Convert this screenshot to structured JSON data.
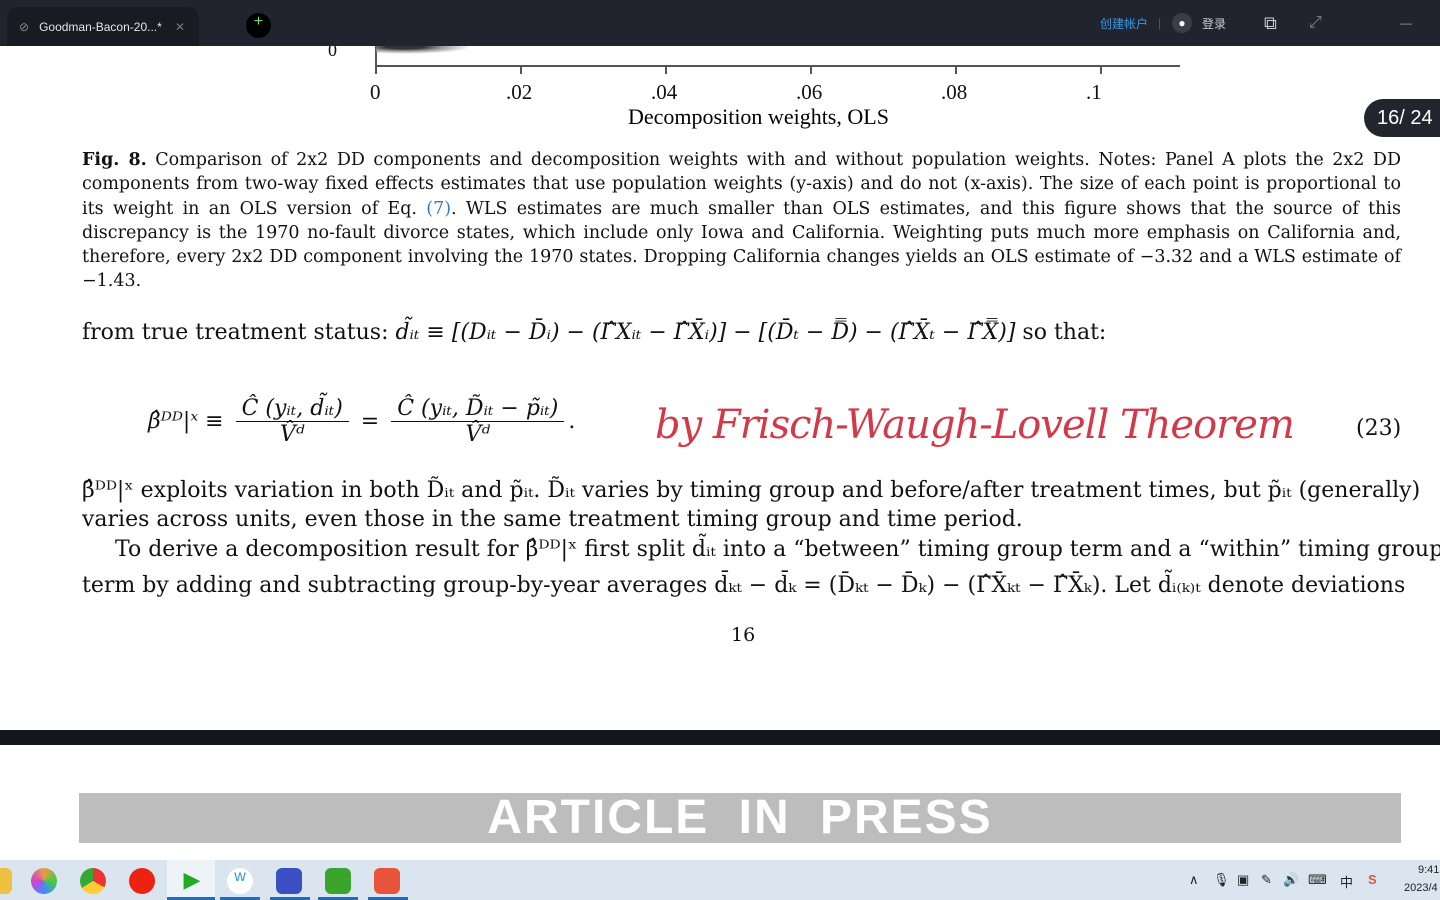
{
  "titlebar": {
    "tab_title": "Goodman-Bacon-20...*",
    "new_tab": "+",
    "create_account": "创建帐户",
    "login": "登录"
  },
  "pager": {
    "label": "16/ 24"
  },
  "figure": {
    "x_ticks": [
      "0",
      ".02",
      ".04",
      ".06",
      ".08",
      ".1"
    ],
    "xlabel": "Decomposition weights, OLS",
    "y_tick": "0"
  },
  "caption": {
    "label": "Fig. 8.",
    "text1": " Comparison of 2x2 DD components and decomposition weights with and without population weights. Notes: Panel A plots the 2x2 DD components from two-way fixed effects estimates that use population weights (y-axis) and do not (x-axis). The size of each point is proportional to its weight in an OLS version of Eq. ",
    "ref": "(7)",
    "text2": ". WLS estimates are much smaller than OLS estimates, and this figure shows that the source of this discrepancy is the 1970 no-fault divorce states, which include only Iowa and California. Weighting puts much more emphasis on California and, therefore, every 2x2 DD component involving the 1970 states. Dropping California changes yields an OLS estimate of −3.32 and a WLS estimate of −1.43."
  },
  "equations": {
    "line1_prefix": "from true treatment status: ",
    "line1_math": "d̃ᵢₜ ≡ [(Dᵢₜ − D̄ᵢ) − (Γ̂Xᵢₜ − Γ̂X̄ᵢ)] − [(D̄ₜ − D̿) − (Γ̂X̄ₜ − Γ̂X̿)]",
    "line1_suffix": " so that:",
    "eq23_lhs": "β̂ᴰᴰ|ˣ ≡",
    "eq23_num1": "Ĉ (yᵢₜ, d̃ᵢₜ)",
    "eq23_den1": "V̂ᵈ",
    "eq23_eq": "=",
    "eq23_num2": "Ĉ (yᵢₜ, D̃ᵢₜ − p̃ᵢₜ)",
    "eq23_den2": "V̂ᵈ",
    "eq23_num": "(23)"
  },
  "annotation": "by Frisch-Waugh-Lovell Theorem",
  "body": {
    "p1a": "β̂ᴰᴰ|ˣ exploits variation in both D̃ᵢₜ and p̃ᵢₜ. D̃ᵢₜ varies by timing group and before/after treatment times, but p̃ᵢₜ (generally)",
    "p1b": "varies across units, even those in the same treatment timing group and time period.",
    "p2a": "To derive a decomposition result for β̂ᴰᴰ|ˣ first split d̃ᵢₜ into a “between” timing group term and a “within” timing group",
    "p2b": "term by adding and subtracting group-by-year averages d̄ₖₜ − d̄ₖ = (D̄ₖₜ − D̄ₖ) − (Γ̂X̄ₖₜ − Γ̂X̄ₖ). Let d̃ᵢ₍ₖ₎ₜ denote deviations",
    "page_number": "16"
  },
  "banner": "ARTICLE IN PRESS",
  "taskbar": {
    "time": "9:41",
    "date": "2023/4",
    "ime": "中"
  }
}
